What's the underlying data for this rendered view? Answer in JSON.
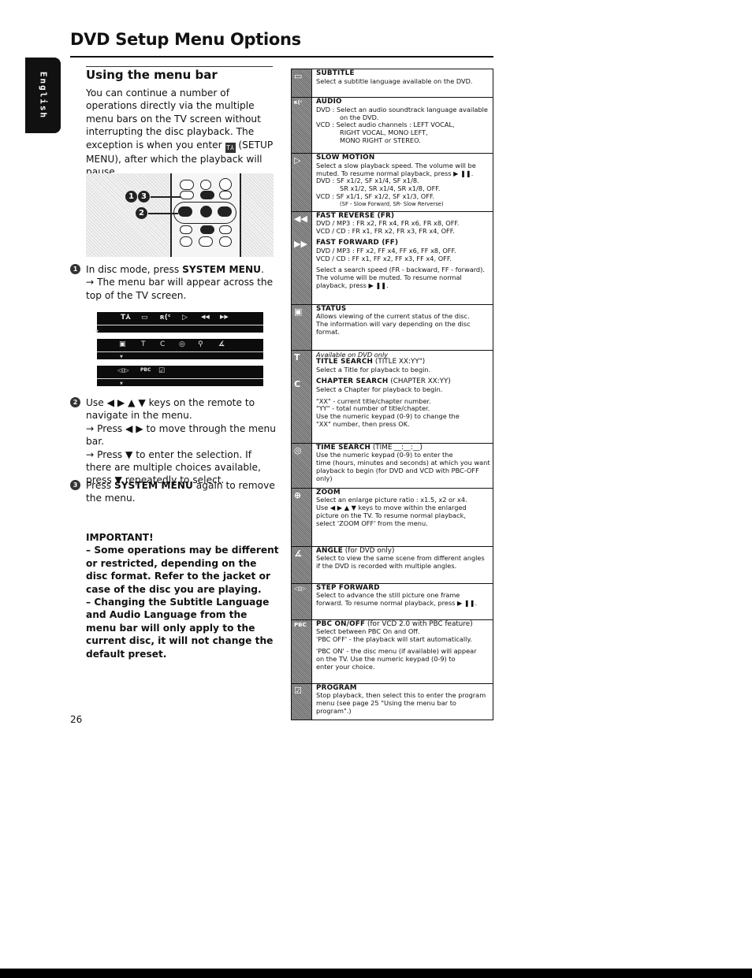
{
  "page": {
    "title": "DVD Setup Menu Options",
    "language_tab": "English",
    "page_number": "26"
  },
  "left": {
    "section_title": "Using the menu bar",
    "intro_a": "You can continue a number of operations directly via the multiple menu bars on the TV screen without interrupting the disc playback. The exception is when you enter ",
    "intro_icon": "setup-menu-icon",
    "intro_b": " (SETUP MENU), after which the playback will pause.",
    "remote": {
      "callout_1": "1",
      "callout_3": "3",
      "callout_2": "2",
      "callout_sep": ","
    },
    "step1": {
      "num": "1",
      "text_a": "In disc mode, press ",
      "text_b": "SYSTEM MENU",
      "text_c": ".",
      "sub": "→ The menu bar will appear across the top of the TV screen."
    },
    "menu_bars": [
      {
        "icons": [
          "setup",
          "subtitle",
          "audio",
          "slow-motion",
          "fast-reverse",
          "fast-forward"
        ],
        "glyphs": [
          "T⅄",
          "▭",
          "ʀ(ᶜ",
          "▷",
          "◀◀",
          "▶▶"
        ]
      },
      {
        "icons": [
          "status",
          "title-search",
          "chapter-search",
          "time-search",
          "zoom",
          "angle"
        ],
        "glyphs": [
          "▣",
          "T",
          "C",
          "◎",
          "⚲",
          "∡"
        ]
      },
      {
        "icons": [
          "step-forward",
          "pbc",
          "program"
        ],
        "glyphs": [
          "◁▯▷",
          "PBC",
          "☑"
        ]
      }
    ],
    "step2": {
      "num": "2",
      "text_a": "Use ◀ ▶ ▲ ▼ keys on the remote to navigate in the menu.",
      "sub1": "→ Press ◀ ▶ to move through the menu bar.",
      "sub2": "→ Press ▼ to enter the selection. If there are multiple choices available, press ▼ repeatedly to select."
    },
    "step3": {
      "num": "3",
      "text_a": "Press ",
      "text_b": "SYSTEM MENU",
      "text_c": " again to remove the menu."
    },
    "important": {
      "heading": "IMPORTANT!",
      "p1": "– Some operations may be different or restricted, depending on the disc format. Refer to the jacket or case of the disc you are playing.",
      "p2": "– Changing the Subtitle Language and Audio Language from the menu bar will only apply to the current disc, it will not change the default preset."
    }
  },
  "table": {
    "rows": [
      {
        "icon": "subtitle-icon",
        "glyph": "▭",
        "heading": "SUBTITLE",
        "lines": [
          "Select a subtitle language available on the DVD."
        ]
      },
      {
        "icon": "audio-icon",
        "glyph": "ʀ(ᶜ",
        "heading": "AUDIO",
        "lines": [
          "DVD :  Select an audio soundtrack language available",
          "on the DVD.",
          "VCD :  Select audio channels : LEFT VOCAL,",
          "RIGHT VOCAL, MONO LEFT,",
          "MONO RIGHT or STEREO."
        ]
      },
      {
        "icon": "slow-motion-icon",
        "glyph": "▷",
        "heading": "SLOW MOTION",
        "lines": [
          "Select a slow playback speed. The volume will be",
          "muted.  To resume normal playback, press  ▶ ❚❚.",
          "DVD :  SF x1/2, SF x1/4, SF x1/8.",
          "SR x1/2, SR x1/4, SR x1/8, OFF.",
          "VCD :  SF x1/1, SF x1/2, SF x1/3, OFF.",
          "(SF - Slow Forward, SR- Slow Rerverse)"
        ]
      },
      {
        "icon": "fast-reverse-icon",
        "glyph": "◀◀",
        "icon2": "fast-forward-icon",
        "glyph2": "▶▶",
        "heading": "FAST REVERSE (FR)",
        "lines": [
          "DVD / MP3 : FR x2, FR x4, FR x6, FR x8, OFF.",
          "VCD / CD : FR x1, FR x2, FR x3, FR x4, OFF."
        ],
        "heading2": "FAST FORWARD (FF)",
        "lines2": [
          "DVD / MP3 : FF x2, FF x4, FF x6, FF x8, OFF.",
          "VCD / CD : FF x1, FF x2, FF x3, FF x4, OFF."
        ],
        "lines3": [
          "Select a search speed (FR - backward, FF - forward).",
          "The volume will be muted.  To resume normal",
          "playback, press  ▶ ❚❚."
        ]
      },
      {
        "icon": "status-icon",
        "glyph": "▣",
        "heading": "STATUS",
        "lines": [
          "Allows viewing of the current status of the disc.",
          "The information will vary depending on the disc",
          "format."
        ]
      },
      {
        "icon": "title-search-icon",
        "glyph": "T",
        "icon2": "chapter-search-icon",
        "glyph2": "C",
        "note": "Available on DVD only",
        "heading": "TITLE SEARCH",
        "heading_suffix": " (TITLE XX:YY\")",
        "lines": [
          "Select a Title for playback to begin."
        ],
        "heading2": "CHAPTER SEARCH",
        "heading2_suffix": " (CHAPTER XX:YY)",
        "lines2": [
          "Select a Chapter for playback to begin."
        ],
        "lines3": [
          "\"XX\" - current title/chapter number.",
          "\"YY\" - total number of title/chapter.",
          "Use the numeric keypad (0-9) to change the",
          "\"XX\" number, then press OK."
        ]
      },
      {
        "icon": "time-search-icon",
        "glyph": "◎",
        "heading": "TIME SEARCH",
        "heading_suffix": " (TIME __:__:__)",
        "lines": [
          "Use the numeric keypad (0-9) to enter the",
          "time (hours, minutes and seconds) at which you want",
          "playback to begin (for DVD and VCD with PBC-OFF",
          "only)"
        ]
      },
      {
        "icon": "zoom-icon",
        "glyph": "⊕",
        "heading": "ZOOM",
        "lines": [
          "Select an enlarge picture ratio : x1.5, x2 or x4.",
          "Use ◀ ▶ ▲ ▼ keys to move within the enlarged",
          "picture on the TV. To resume normal playback,",
          "select 'ZOOM OFF' from the menu."
        ]
      },
      {
        "icon": "angle-icon",
        "glyph": "∡",
        "heading": "ANGLE",
        "heading_suffix": " (for DVD only)",
        "lines": [
          "Select to view the same scene from different angles",
          "if the DVD is recorded with multiple angles."
        ]
      },
      {
        "icon": "step-forward-icon",
        "glyph": "◁▯▷",
        "heading": "STEP FORWARD",
        "lines": [
          "Select to advance the still picture one frame",
          "forward. To resume normal playback, press  ▶ ❚❚."
        ]
      },
      {
        "icon": "pbc-icon",
        "glyph": "PBC",
        "heading": "PBC ON/OFF",
        "heading_suffix": " (for VCD 2.0 with PBC feature)",
        "lines": [
          "Select between PBC On and Off.",
          "'PBC OFF' - the playback will start automatically."
        ],
        "lines3": [
          "'PBC ON' - the disc menu (if available) will appear",
          "on the TV. Use the numeric keypad (0-9) to",
          "enter your choice."
        ]
      },
      {
        "icon": "program-icon",
        "glyph": "☑",
        "heading": "PROGRAM",
        "lines": [
          "Stop playback, then select this to enter the program",
          "menu (see page 25 \"Using the menu bar to program\".)"
        ]
      }
    ]
  }
}
